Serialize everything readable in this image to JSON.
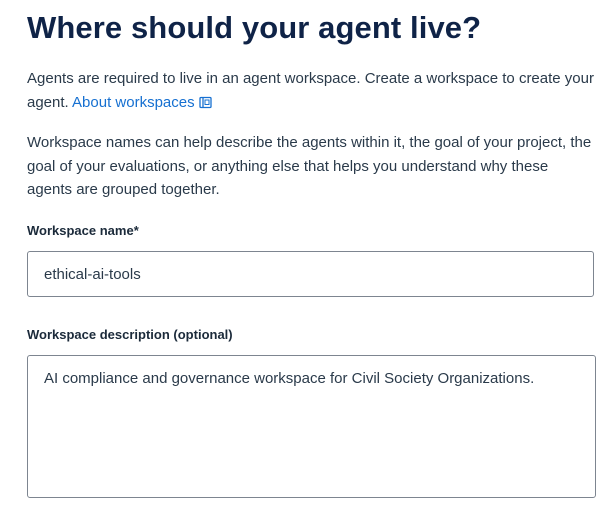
{
  "heading": "Where should your agent live?",
  "intro": {
    "text": "Agents are required to live in an agent workspace. Create a workspace to create your agent. ",
    "link_label": "About workspaces",
    "link_icon": "document-icon"
  },
  "description_text": "Workspace names can help describe the agents within it, the goal of your project, the goal of your evaluations, or anything else that helps you understand why these agents are grouped together.",
  "form": {
    "name_label": "Workspace name",
    "name_required_mark": "*",
    "name_value": "ethical-ai-tools",
    "description_label": "Workspace description (optional)",
    "description_value": "AI compliance and governance workspace for Civil Society Organizations."
  },
  "colors": {
    "heading": "#0f2347",
    "link": "#1670d1",
    "input_border": "#7d8590"
  }
}
